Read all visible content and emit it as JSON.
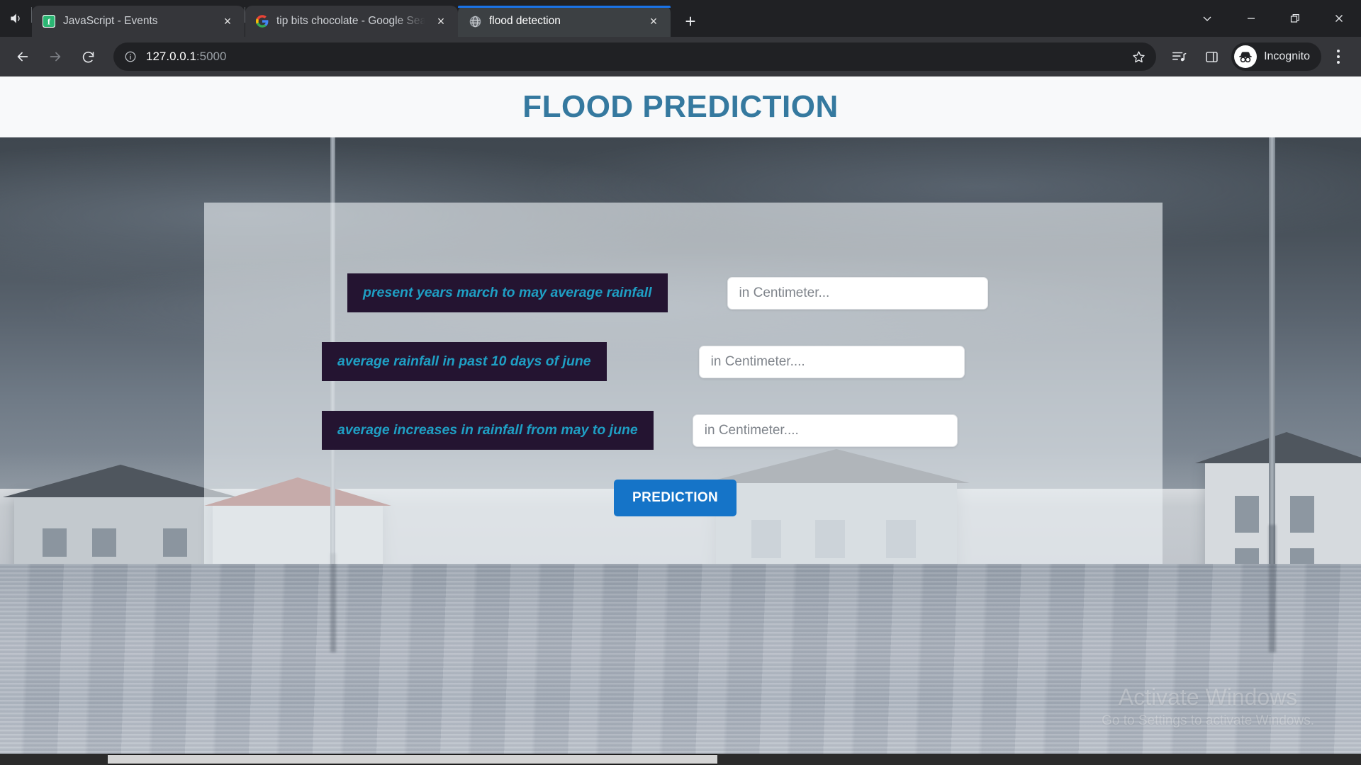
{
  "browser": {
    "audio_icon": "speaker-icon",
    "tabs": [
      {
        "favicon": "js-tutorial-icon",
        "title": "JavaScript - Events",
        "active": false,
        "close_label": "×"
      },
      {
        "favicon": "google-icon",
        "title": "tip bits chocolate - Google Search",
        "active": false,
        "close_label": "×"
      },
      {
        "favicon": "globe-icon",
        "title": "flood detection",
        "active": true,
        "close_label": "×"
      }
    ],
    "new_tab_label": "+",
    "window_controls": {
      "chevron": "chevron-down-icon",
      "minimize": "minimize-icon",
      "maximize": "restore-icon",
      "close": "close-icon"
    },
    "toolbar": {
      "back": "back-arrow-icon",
      "forward": "forward-arrow-icon",
      "reload": "reload-icon",
      "site_info_icon": "info-circle-icon",
      "url_host": "127.0.0.1",
      "url_port": ":5000",
      "bookmark_icon": "star-icon",
      "media_icon": "media-list-icon",
      "side_panel_icon": "side-panel-icon",
      "profile_icon": "incognito-icon",
      "profile_label": "Incognito",
      "menu_icon": "three-dot-menu-icon"
    }
  },
  "page": {
    "title": "FLOOD PREDICTION",
    "title_color": "#35799f",
    "form": {
      "fields": [
        {
          "label": "present years march to may average rainfall",
          "placeholder": "in Centimeter...",
          "value": ""
        },
        {
          "label": "average rainfall in past 10 days of june",
          "placeholder": "in Centimeter....",
          "value": ""
        },
        {
          "label": "average increases in rainfall from may to june",
          "placeholder": "in Centimeter....",
          "value": ""
        }
      ],
      "submit_label": "PREDICTION",
      "submit_color": "#1574c8",
      "label_bg": "#241431",
      "label_color": "#1f9fc4"
    }
  },
  "watermark": {
    "title": "Activate Windows",
    "subtitle": "Go to Settings to activate Windows."
  }
}
